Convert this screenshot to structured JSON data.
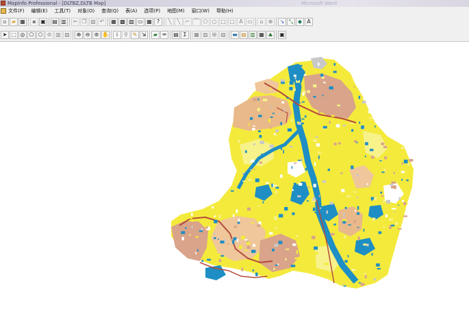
{
  "window": {
    "title": "MapInfo Professional - [DLTBZ,DLTB Map]",
    "background_title": "Microsoft Word"
  },
  "menu": [
    {
      "label": "文件(F)"
    },
    {
      "label": "编辑(E)"
    },
    {
      "label": "工具(T)"
    },
    {
      "label": "对象(O)"
    },
    {
      "label": "查询(Q)"
    },
    {
      "label": "表(A)"
    },
    {
      "label": "选项(P)"
    },
    {
      "label": "地图(M)"
    },
    {
      "label": "窗口(W)"
    },
    {
      "label": "帮助(H)"
    }
  ],
  "toolbar_main": [
    {
      "icon": "new-file-icon",
      "glyph": "▫"
    },
    {
      "icon": "open-folder-icon",
      "glyph": "▰",
      "color": "#d9a73a"
    },
    {
      "icon": "open-workspace-icon",
      "glyph": "▦"
    },
    {
      "sep": true
    },
    {
      "icon": "save-icon",
      "glyph": "▪",
      "disabled": true
    },
    {
      "icon": "save-workspace-icon",
      "glyph": "▣"
    },
    {
      "sep": true
    },
    {
      "icon": "print-preview-icon",
      "glyph": "▤"
    },
    {
      "icon": "print-icon",
      "glyph": "▥"
    },
    {
      "sep": true
    },
    {
      "icon": "cut-icon",
      "glyph": "✂",
      "disabled": true
    },
    {
      "icon": "copy-icon",
      "glyph": "❐",
      "disabled": true
    },
    {
      "icon": "paste-icon",
      "glyph": "▧",
      "disabled": true
    },
    {
      "icon": "undo-icon",
      "glyph": "↶",
      "disabled": true
    },
    {
      "sep": true
    },
    {
      "icon": "new-browser-icon",
      "glyph": "▦"
    },
    {
      "icon": "new-map-window-icon",
      "glyph": "▩"
    },
    {
      "icon": "new-graph-icon",
      "glyph": "▨"
    },
    {
      "icon": "new-layout-icon",
      "glyph": "▭"
    },
    {
      "icon": "new-redistrict-icon",
      "glyph": "▦"
    },
    {
      "icon": "help-pointer-icon",
      "glyph": "?"
    },
    {
      "sep": true
    },
    {
      "icon": "symbol-style-icon",
      "glyph": "╲",
      "disabled": true
    },
    {
      "icon": "line-tool-icon",
      "glyph": "╲",
      "disabled": true
    },
    {
      "icon": "polyline-tool-icon",
      "glyph": "⌐",
      "disabled": true
    },
    {
      "icon": "arc-tool-icon",
      "glyph": "⌒",
      "disabled": true
    },
    {
      "icon": "polygon-tool-icon",
      "glyph": "⬠",
      "disabled": true
    },
    {
      "icon": "ellipse-tool-icon",
      "glyph": "○",
      "disabled": true
    },
    {
      "icon": "rectangle-tool-icon",
      "glyph": "□",
      "disabled": true
    },
    {
      "icon": "rounded-rect-tool-icon",
      "glyph": "▢",
      "disabled": true
    },
    {
      "icon": "text-tool-icon",
      "glyph": "A",
      "disabled": true
    },
    {
      "icon": "frame-tool-icon",
      "glyph": "▭",
      "disabled": true
    },
    {
      "sep": true
    },
    {
      "icon": "reshape-icon",
      "glyph": "⌂",
      "disabled": true
    },
    {
      "icon": "add-node-icon",
      "glyph": "⊕",
      "disabled": true
    },
    {
      "sep": true
    },
    {
      "icon": "line-style-icon",
      "glyph": "↘",
      "color": "#3a54b5"
    },
    {
      "icon": "region-style-icon",
      "glyph": "⤡",
      "color": "#2a6e2a"
    },
    {
      "icon": "symbol-picker-icon",
      "glyph": "◆",
      "color": "#1f7a5a"
    },
    {
      "icon": "text-style-icon",
      "glyph": "A"
    }
  ],
  "toolbar_map": [
    {
      "icon": "select-arrow-icon",
      "glyph": "➤"
    },
    {
      "icon": "marquee-select-icon",
      "glyph": "⬚"
    },
    {
      "icon": "radius-select-icon",
      "glyph": "◎"
    },
    {
      "icon": "polygon-select-icon",
      "glyph": "⬠"
    },
    {
      "icon": "boundary-select-icon",
      "glyph": "⬡"
    },
    {
      "icon": "unselect-all-icon",
      "glyph": "⊘",
      "disabled": true
    },
    {
      "icon": "invert-selection-icon",
      "glyph": "▥",
      "disabled": true
    },
    {
      "icon": "graph-select-icon",
      "glyph": "▧",
      "disabled": true
    },
    {
      "sep": true
    },
    {
      "icon": "zoom-in-icon",
      "glyph": "⊕"
    },
    {
      "icon": "zoom-out-icon",
      "glyph": "⊖"
    },
    {
      "icon": "change-view-icon",
      "glyph": "⊚"
    },
    {
      "icon": "grabber-hand-icon",
      "glyph": "✋"
    },
    {
      "sep": true
    },
    {
      "icon": "info-tool-icon",
      "glyph": "i"
    },
    {
      "icon": "hotlink-icon",
      "glyph": "⚲",
      "disabled": true
    },
    {
      "icon": "label-tool-icon",
      "glyph": "✎",
      "color": "#c58a1a"
    },
    {
      "icon": "drag-map-icon",
      "glyph": "⇲"
    },
    {
      "sep": true
    },
    {
      "icon": "layer-control-icon",
      "glyph": "▰",
      "color": "#2f7a2f"
    },
    {
      "icon": "ruler-icon",
      "glyph": "═"
    },
    {
      "sep": true
    },
    {
      "icon": "legend-icon",
      "glyph": "▤"
    },
    {
      "icon": "statistics-icon",
      "glyph": "Σ"
    },
    {
      "sep": true
    },
    {
      "icon": "clip-region-icon",
      "glyph": "▦",
      "disabled": true
    },
    {
      "icon": "set-target-icon",
      "glyph": "▨",
      "disabled": true
    },
    {
      "icon": "split-icon",
      "glyph": "⊞",
      "disabled": true
    },
    {
      "icon": "erase-icon",
      "glyph": "▧",
      "disabled": true
    },
    {
      "sep": true
    },
    {
      "icon": "scale-bar-icon",
      "glyph": "▬",
      "color": "#2a6ea0"
    },
    {
      "icon": "map-layout-icon",
      "glyph": "▤",
      "color": "#c5902a"
    },
    {
      "icon": "thematic-map-icon",
      "glyph": "▥",
      "color": "#2f7a2f"
    },
    {
      "icon": "create-grid-icon",
      "glyph": "▦"
    },
    {
      "icon": "3d-map-icon",
      "glyph": "⛰",
      "color": "#3a7a3a"
    },
    {
      "sep": true
    },
    {
      "icon": "overview-window-icon",
      "glyph": "▣"
    }
  ],
  "map": {
    "colors": {
      "river_blue": "#1e8ec4",
      "yellow_land": "#f4ea3c",
      "pale_yellow": "#f7f28a",
      "salmon": "#d9a48a",
      "tan": "#e9b98a",
      "peach": "#efc79a",
      "grey": "#c8c8c8",
      "road": "#b44a3a",
      "white": "#ffffff"
    }
  }
}
